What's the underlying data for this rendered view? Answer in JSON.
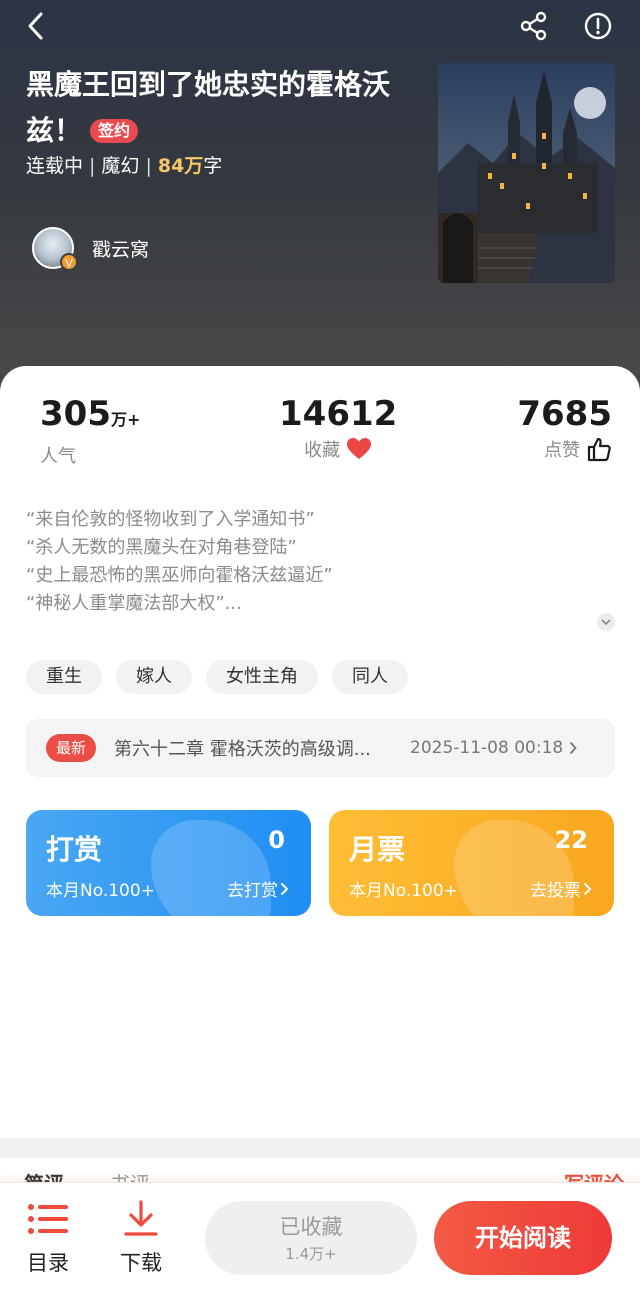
{
  "header": {
    "back_icon": "chevron-left-icon",
    "share_icon": "share-icon",
    "info_icon": "alert-circle-icon"
  },
  "book": {
    "title": "黑魔王回到了她忠实的霍格沃兹！",
    "sign_badge": "签约",
    "status": "连载中",
    "genre": "魔幻",
    "word_count": "84万",
    "word_unit": "字",
    "author": "戳云窝",
    "author_badge": "V"
  },
  "stats": {
    "popularity": {
      "value": "305",
      "unit": "万+",
      "label": "人气"
    },
    "favorites": {
      "value": "14612",
      "label": "收藏"
    },
    "likes": {
      "value": "7685",
      "label": "点赞"
    }
  },
  "intro": [
    "“来自伦敦的怪物收到了入学通知书”",
    "“杀人无数的黑魔头在对角巷登陆”",
    "“史上最恐怖的黑巫师向霍格沃兹逼近”",
    "“神秘人重掌魔法部大权”..."
  ],
  "tags": [
    "重生",
    "嫁人",
    "女性主角",
    "同人"
  ],
  "latest": {
    "badge": "最新",
    "chapter": "第六十二章 霍格沃茨的高级调...",
    "time": "2025-11-08 00:18"
  },
  "reward": {
    "title": "打赏",
    "count": "0",
    "rank": "本月No.100+",
    "action": "去打赏"
  },
  "ticket": {
    "title": "月票",
    "count": "22",
    "rank": "本月No.100+",
    "action": "去投票"
  },
  "reviews": {
    "tab1": "简评",
    "tab2": "书评",
    "write": "写评论"
  },
  "bottom": {
    "toc": "目录",
    "download": "下载",
    "collected": "已收藏",
    "collected_count": "1.4万+",
    "read": "开始阅读"
  },
  "colors": {
    "accent": "#ea4d46",
    "reward_blue": "#1f8ef3",
    "ticket_orange": "#f8a720",
    "word_count": "#f6c86a"
  }
}
